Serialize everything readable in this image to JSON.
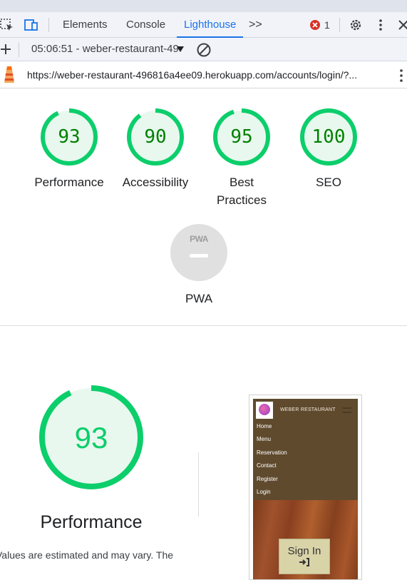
{
  "devtools": {
    "tabs": [
      "Elements",
      "Console",
      "Lighthouse"
    ],
    "active_tab": "Lighthouse",
    "overflow_glyph": ">>",
    "error_count": "1",
    "session_label": "05:06:51 - weber-restaurant-49",
    "url": "https://weber-restaurant-496816a4ee09.herokuapp.com/accounts/login/?..."
  },
  "scores": [
    {
      "value": "93",
      "label": "Performance",
      "fraction": 0.93
    },
    {
      "value": "90",
      "label": "Accessibility",
      "fraction": 0.9
    },
    {
      "value": "95",
      "label": "Best",
      "label2": "Practices",
      "fraction": 0.95
    },
    {
      "value": "100",
      "label": "SEO",
      "fraction": 1.0
    }
  ],
  "pwa": {
    "badge": "PWA",
    "label": "PWA"
  },
  "detail": {
    "score": "93",
    "fraction": 0.93,
    "title": "Performance",
    "note": "Values are estimated and may vary. The"
  },
  "thumbnail": {
    "brand": "WEBER RESTAURANT",
    "nav": [
      "Home",
      "Menu",
      "Reservation",
      "Contact",
      "Register",
      "Login"
    ],
    "signin": "Sign In"
  },
  "colors": {
    "pass": "#0cce6b",
    "pass_bg": "#e8f8ee",
    "pass_text": "#008000",
    "accent": "#1a73e8"
  }
}
